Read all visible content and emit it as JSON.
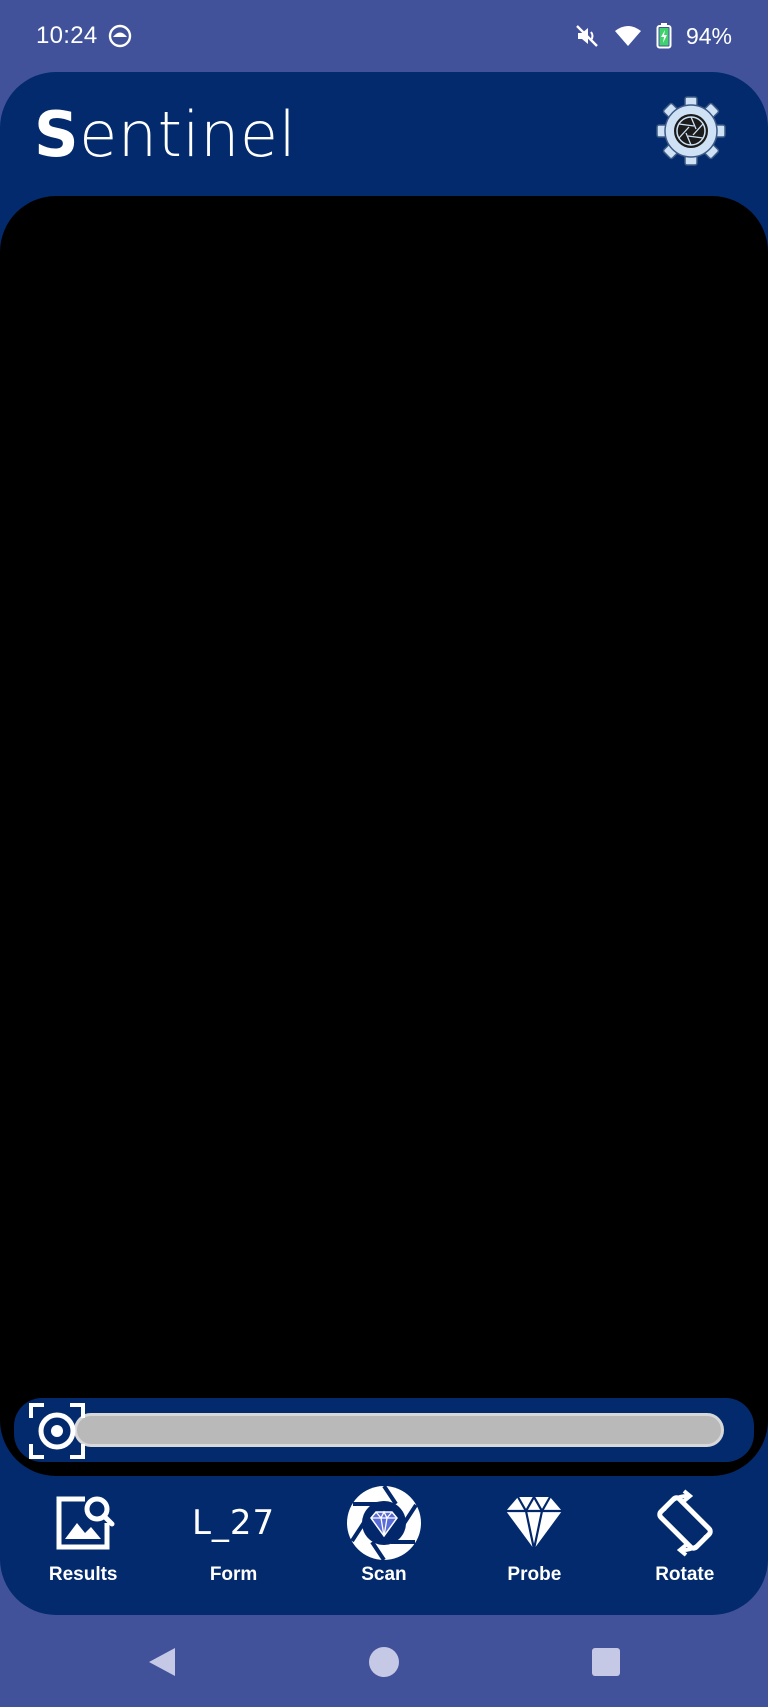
{
  "status_bar": {
    "time": "10:24",
    "battery": "94%",
    "icons": [
      "android-head-icon",
      "mute-icon",
      "wifi-icon",
      "battery-charging-icon"
    ]
  },
  "app": {
    "title_first": "S",
    "title_rest": "entinel",
    "settings_icon": "gear-shutter-icon"
  },
  "zoom": {
    "icon": "focus-icon",
    "level_percent": 0
  },
  "bottom_nav": {
    "results_label": "Results",
    "form_code": "L_27",
    "form_label": "Form",
    "scan_label": "Scan",
    "probe_label": "Probe",
    "rotate_label": "Rotate"
  },
  "system_nav": {
    "icons": [
      "back-icon",
      "home-icon",
      "recents-icon"
    ]
  },
  "colors": {
    "background": "#41529b",
    "card": "#022a6c",
    "viewport": "#000000",
    "scan_accent": "#5a6cd8"
  }
}
